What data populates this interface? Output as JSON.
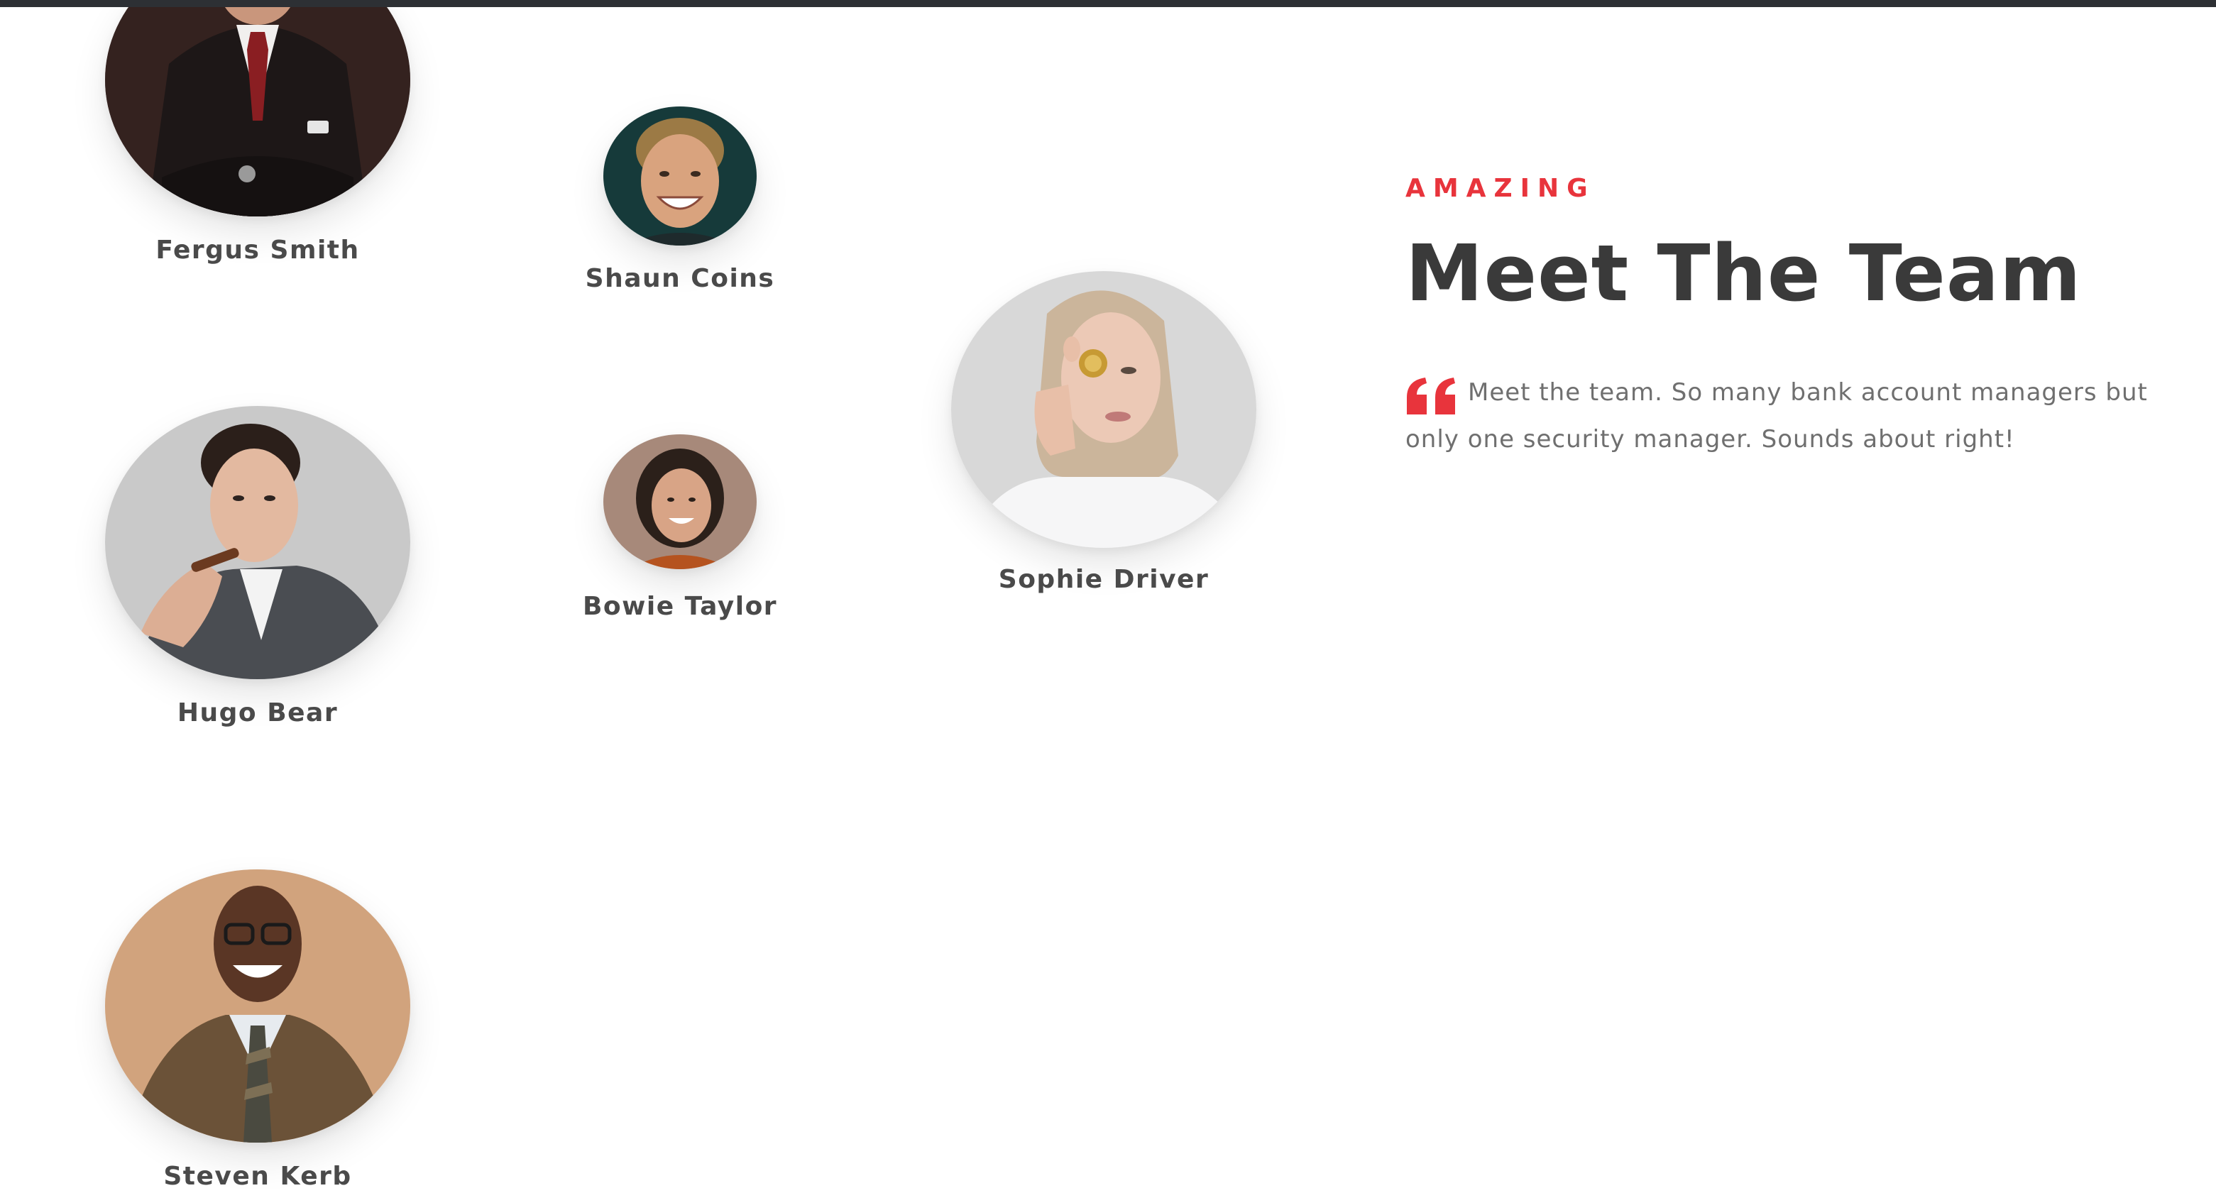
{
  "intro": {
    "eyebrow": "AMAZING",
    "headline": "Meet The Team",
    "description": "Meet the team. So many bank account managers but only one security manager. Sounds about right!"
  },
  "team": [
    {
      "name": "Fergus Smith"
    },
    {
      "name": "Shaun Coins"
    },
    {
      "name": "Sophie Driver"
    },
    {
      "name": "Hugo Bear"
    },
    {
      "name": "Bowie Taylor"
    },
    {
      "name": "Steven Kerb"
    }
  ],
  "colors": {
    "accent": "#e8343c",
    "heading": "#3a3a3a",
    "text": "#6f6f6f",
    "top_bar": "#2d3034"
  },
  "icons": {
    "quote": "quote-icon"
  }
}
